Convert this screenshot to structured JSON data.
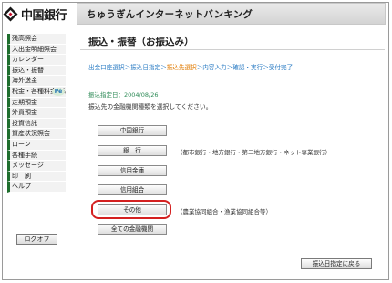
{
  "header": {
    "bank_name": "中国銀行",
    "service_title": "ちゅうぎんインターネットバンキング"
  },
  "sidebar": {
    "items": [
      {
        "label": "残高照会"
      },
      {
        "label": "入出金明細照会"
      },
      {
        "label": "カレンダー"
      },
      {
        "label": "振込・振替"
      },
      {
        "label": "海外送金"
      },
      {
        "label": "税金・各種料金払込",
        "badge": "Pe"
      },
      {
        "label": "定期預金"
      },
      {
        "label": "外貨預金"
      },
      {
        "label": "投資信託"
      },
      {
        "label": "資産状況照会"
      },
      {
        "label": "ローン"
      },
      {
        "label": "各種手続"
      },
      {
        "label": "メッセージ"
      },
      {
        "label": "印　刷"
      },
      {
        "label": "ヘルプ"
      }
    ],
    "logoff_label": "ログオフ"
  },
  "main": {
    "page_title": "振込・振替（お振込み）",
    "steps": [
      "出金口座選択",
      "振込日指定",
      "振込先選択",
      "内容入力",
      "確認・実行",
      "受付完了"
    ],
    "current_step": "振込先選択",
    "date_line": "振込指定日：2004/08/26",
    "instruction": "振込先の金融機関種類を選択してください。",
    "bank_buttons": [
      {
        "label": "中国銀行",
        "desc": ""
      },
      {
        "label": "銀　行",
        "desc": "（都市銀行・地方銀行・第二地方銀行・ネット専業銀行）"
      },
      {
        "label": "信用金庫",
        "desc": ""
      },
      {
        "label": "信用組合",
        "desc": ""
      },
      {
        "label": "その他",
        "desc": "（農業協同組合・漁業協同組合等）"
      },
      {
        "label": "全ての金融機関",
        "desc": ""
      }
    ],
    "back_button": "振込日指定に戻る"
  },
  "colors": {
    "accent_green": "#1f6e2d",
    "link_blue": "#2b7cc4",
    "current_orange": "#e07a00",
    "highlight_red": "#d42020"
  }
}
